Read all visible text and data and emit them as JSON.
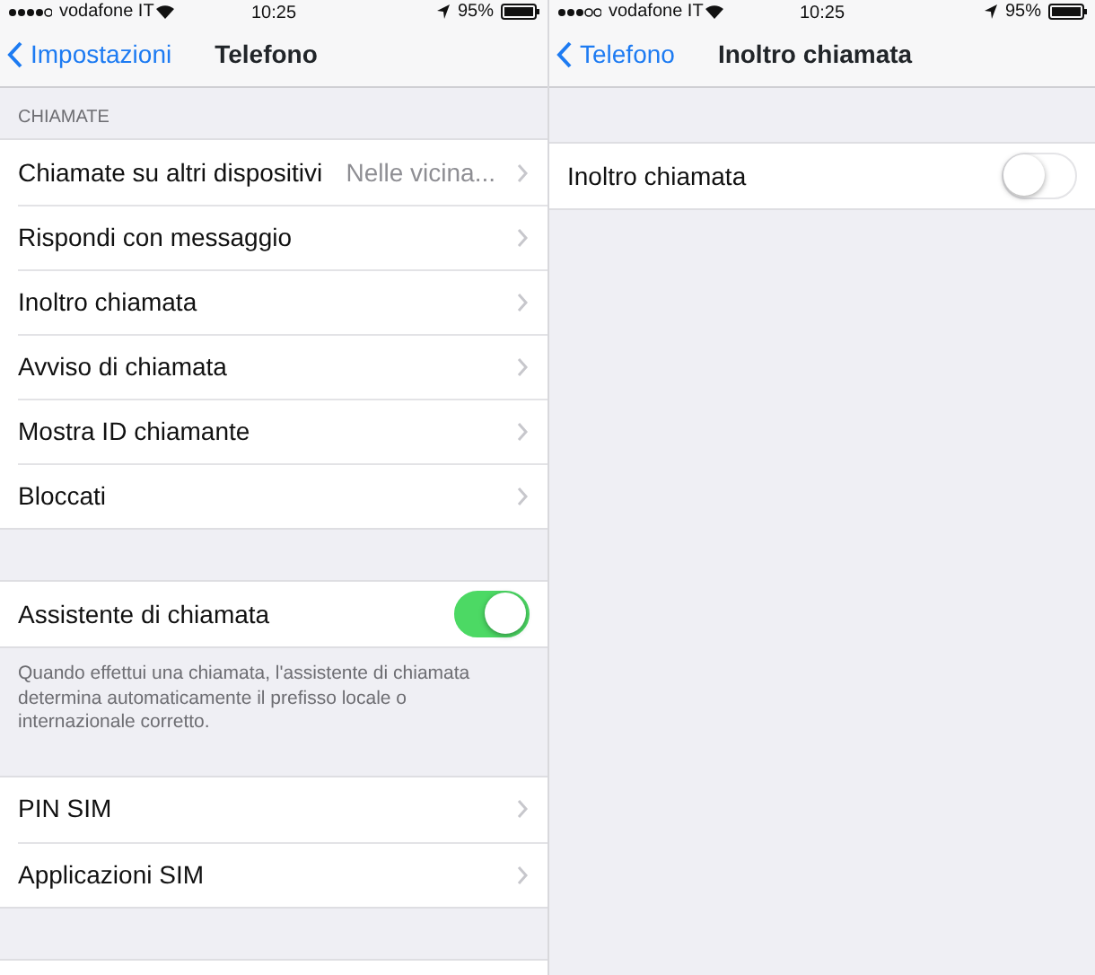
{
  "screens": [
    {
      "status_bar": {
        "signal_dots": [
          true,
          true,
          true,
          true,
          false
        ],
        "carrier": "vodafone IT",
        "time": "10:25",
        "battery": "95%"
      },
      "nav": {
        "back": "Impostazioni",
        "title": "Telefono"
      },
      "groups": [
        {
          "header": "CHIAMATE",
          "rows": [
            {
              "kind": "link",
              "label": "Chiamate su altri dispositivi",
              "value": "Nelle vicina..."
            },
            {
              "kind": "link",
              "label": "Rispondi con messaggio"
            },
            {
              "kind": "link",
              "label": "Inoltro chiamata"
            },
            {
              "kind": "link",
              "label": "Avviso di chiamata"
            },
            {
              "kind": "link",
              "label": "Mostra ID chiamante"
            },
            {
              "kind": "link",
              "label": "Bloccati"
            }
          ]
        },
        {
          "rows": [
            {
              "kind": "toggle",
              "label": "Assistente di chiamata",
              "on": true
            }
          ],
          "footer": "Quando effettui una chiamata, l'assistente di chiamata determina automaticamente il prefisso locale o internazionale corretto."
        },
        {
          "rows": [
            {
              "kind": "link",
              "label": "PIN SIM"
            },
            {
              "kind": "link",
              "label": "Applicazioni SIM"
            }
          ]
        },
        {
          "rows": [
            {
              "kind": "blank"
            }
          ]
        }
      ]
    },
    {
      "status_bar": {
        "signal_dots": [
          true,
          true,
          true,
          false,
          false
        ],
        "carrier": "vodafone IT",
        "time": "10:25",
        "battery": "95%"
      },
      "nav": {
        "back": "Telefono",
        "title": "Inoltro chiamata"
      },
      "groups": [
        {
          "rows": [
            {
              "kind": "toggle",
              "label": "Inoltro chiamata",
              "on": false
            }
          ]
        }
      ]
    }
  ]
}
